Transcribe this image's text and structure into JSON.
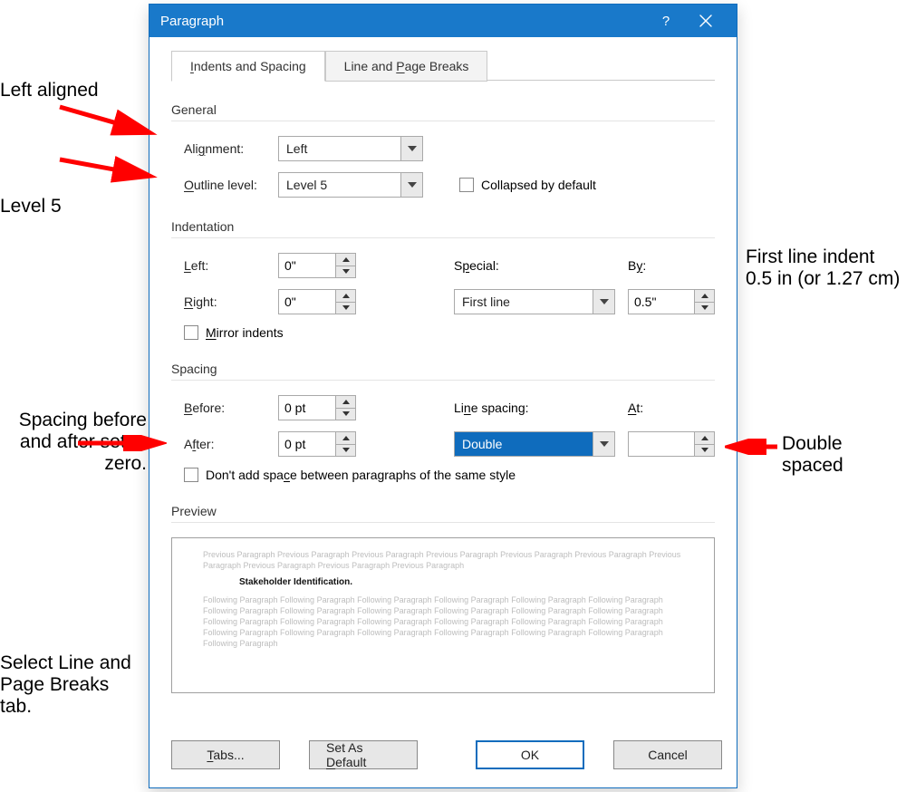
{
  "dialog": {
    "title": "Paragraph"
  },
  "tabs": {
    "indents": "Indents and Spacing",
    "linebreaks": "Line and Page Breaks"
  },
  "general": {
    "legend": "General",
    "alignment_label": "Alignment:",
    "alignment_value": "Left",
    "outline_label": "Outline level:",
    "outline_value": "Level 5",
    "collapsed_label": "Collapsed by default"
  },
  "indent": {
    "legend": "Indentation",
    "left_label": "Left:",
    "left_value": "0\"",
    "right_label": "Right:",
    "right_value": "0\"",
    "special_label": "Special:",
    "special_value": "First line",
    "by_label": "By:",
    "by_value": "0.5\"",
    "mirror_label": "Mirror indents"
  },
  "spacing": {
    "legend": "Spacing",
    "before_label": "Before:",
    "before_value": "0 pt",
    "after_label": "After:",
    "after_value": "0 pt",
    "line_label": "Line spacing:",
    "line_value": "Double",
    "at_label": "At:",
    "at_value": "",
    "nospace_label": "Don't add space between paragraphs of the same style"
  },
  "preview": {
    "legend": "Preview",
    "prev_line": "Previous Paragraph Previous Paragraph Previous Paragraph Previous Paragraph Previous Paragraph Previous Paragraph Previous Paragraph Previous Paragraph Previous Paragraph Previous Paragraph",
    "heading": "Stakeholder Identification.",
    "next_line": "Following Paragraph Following Paragraph Following Paragraph Following Paragraph Following Paragraph Following Paragraph Following Paragraph Following Paragraph Following Paragraph Following Paragraph Following Paragraph Following Paragraph Following Paragraph Following Paragraph Following Paragraph Following Paragraph Following Paragraph Following Paragraph Following Paragraph Following Paragraph Following Paragraph Following Paragraph Following Paragraph Following Paragraph Following Paragraph"
  },
  "buttons": {
    "tabs": "Tabs...",
    "default": "Set As Default",
    "ok": "OK",
    "cancel": "Cancel"
  },
  "annotations": {
    "left_aligned": "Left aligned",
    "level5": "Level 5",
    "firstline": "First line indent 0.5 in (or 1.27 cm)",
    "spacing_zero": "Spacing before and after set to zero.",
    "double": "Double spaced",
    "select_tab": "Select Line and Page Breaks tab."
  }
}
